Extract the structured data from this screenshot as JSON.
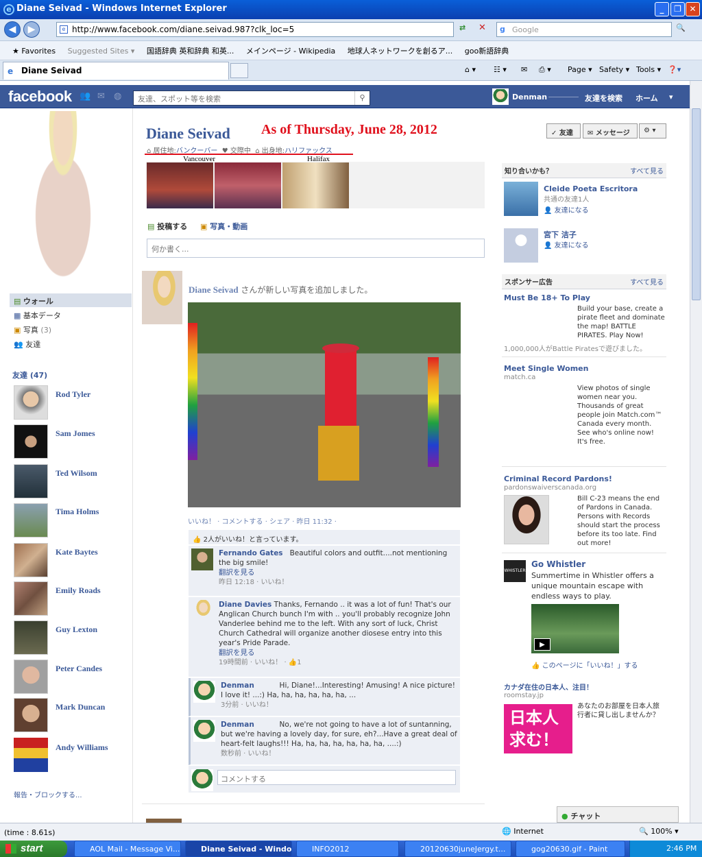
{
  "window": {
    "title": "Diane Seivad  - Windows Internet Explorer",
    "min": "_",
    "max": "❐",
    "close": "✕"
  },
  "browser": {
    "url": "http://www.facebook.com/diane.seivad.987?clk_loc=5",
    "search_placeholder": "Google",
    "favorites": [
      "Favorites",
      "Suggested Sites ▾",
      "国語辞典 英和辞典 和英...",
      "メインページ - Wikipedia",
      "地球人ネットワークを創るア...",
      "goo新語辞典"
    ],
    "tab": "Diane Seivad",
    "tools": [
      "Page ▾",
      "Safety ▾",
      "Tools ▾"
    ]
  },
  "fb": {
    "logo": "facebook",
    "search_placeholder": "友達、スポット等を検索",
    "user": "Denman",
    "find_friends": "友達を検索",
    "home": "ホーム"
  },
  "profile": {
    "name": "Diane Seivad",
    "annotation": "As of Thursday, June 28, 2012",
    "info": [
      {
        "label": "居住地:",
        "value": "バンクーバー"
      },
      {
        "label": "交際中",
        "value": ""
      },
      {
        "label": "出身地:",
        "value": "ハリファックス"
      }
    ],
    "info_notes": [
      "Vancouver",
      "Halifax"
    ],
    "buttons": {
      "friend": "✓ 友達",
      "message": "メッセージ",
      "gear": "⚙ ▾"
    }
  },
  "left_nav": [
    {
      "label": "ウォール",
      "count": ""
    },
    {
      "label": "基本データ",
      "count": ""
    },
    {
      "label": "写真",
      "count": "(3)"
    },
    {
      "label": "友達",
      "count": ""
    }
  ],
  "friends": {
    "header": "友達 (47)",
    "list": [
      "Rod Tyler",
      "Sam Jomes",
      "Ted Wilsom",
      "Tima Holms",
      "Kate Baytes",
      "Emily Roads",
      "Guy Lexton",
      "Peter Candes",
      "Mark Duncan",
      "Andy Williams"
    ]
  },
  "report": "報告・ブロックする...",
  "composer": {
    "tab_post": "投稿する",
    "tab_photo": "写真・動画",
    "placeholder": "何か書く..."
  },
  "post": {
    "author": "Diane Seivad",
    "action": "さんが新しい写真を追加しました。",
    "meta": "いいね！ · コメントする · シェア · 昨日 11:32 ·",
    "likes": "2人がいいね！と言っています。",
    "comments": [
      {
        "name": "Fernando Gates",
        "text": "Beautiful colors and outfit....not mentioning the big smile!",
        "translate": "翻訳を見る",
        "meta": "昨日 12:18 · いいね！"
      },
      {
        "name": "Diane Davies",
        "text": "Thanks, Fernando .. it was a lot of fun! That's our Anglican Church bunch I'm with .. you'll probably recognize John Vanderlee behind me to the left. With any sort of luck, Christ Church Cathedral will organize another diosese entry into this year's Pride Parade.",
        "translate": "翻訳を見る",
        "meta": "19時間前 · いいね！ · 👍1"
      },
      {
        "name": "Denman",
        "text": "Hi, Diane!...Interesting! Amusing! A nice picture! I love it! ...:) Ha, ha, ha, ha, ha, ha, ...",
        "translate": "",
        "meta": "3分前 · いいね！"
      },
      {
        "name": "Denman",
        "text": "No, we're not going to have a lot of suntanning, but we're having a lovely day, for sure, eh?...Have a great deal of heart-felt laughs!!! Ha, ha, ha, ha, ha, ha, ha, ....:)",
        "translate": "",
        "meta": "数秒前 · いいね！"
      }
    ],
    "comment_placeholder": "コメントする"
  },
  "right": {
    "pymk_header": "知り合いかも？",
    "see_all": "すべて見る",
    "pymk": [
      {
        "name": "Cleide Poeta Escritora",
        "sub": "共通の友達1人",
        "action": "友達になる"
      },
      {
        "name": "宮下 洁子",
        "sub": "",
        "action": "友達になる"
      }
    ],
    "ads_header": "スポンサー広告",
    "ads": [
      {
        "title": "Must Be 18+ To Play",
        "url": "",
        "text": "Build your base, create a pirate fleet and dominate the map! BATTLE PIRATES. Play Now!",
        "foot": "1,000,000人がBattle Piratesで遊びました。"
      },
      {
        "title": "Meet Single Women",
        "url": "match.ca",
        "text": "View photos of single women near you. Thousands of great people join Match.com™ Canada every month. See who's online now! It's free.",
        "foot": ""
      },
      {
        "title": "Criminal Record Pardons!",
        "url": "pardonswaiverscanada.org",
        "text": "Bill C-23 means the end of Pardons in Canada. Persons with Records should start the process before its too late. Find out more!",
        "foot": ""
      }
    ],
    "whistler": {
      "title": "Go Whistler",
      "text": "Summertime in Whistler offers a unique mountain escape with endless ways to play.",
      "like": "このページに「いいね！」する"
    },
    "roomstay": {
      "title": "カナダ在住の日本人、注目！",
      "url": "roomstay.jp",
      "banner": "日本人求む！",
      "text": "あなたのお部屋を日本人旅行者に貸し出しませんか？"
    },
    "chat": "チャット"
  },
  "status": {
    "time": "(time : 8.61s)",
    "zone": "Internet",
    "zoom": "100%"
  },
  "taskbar": {
    "start": "start",
    "items": [
      "AOL Mail - Message Vi...",
      "Diane Seivad - Windo...",
      "INFO2012",
      "20120630juneJergy.t...",
      "gog20630.gif - Paint"
    ],
    "clock": "2:46 PM"
  }
}
